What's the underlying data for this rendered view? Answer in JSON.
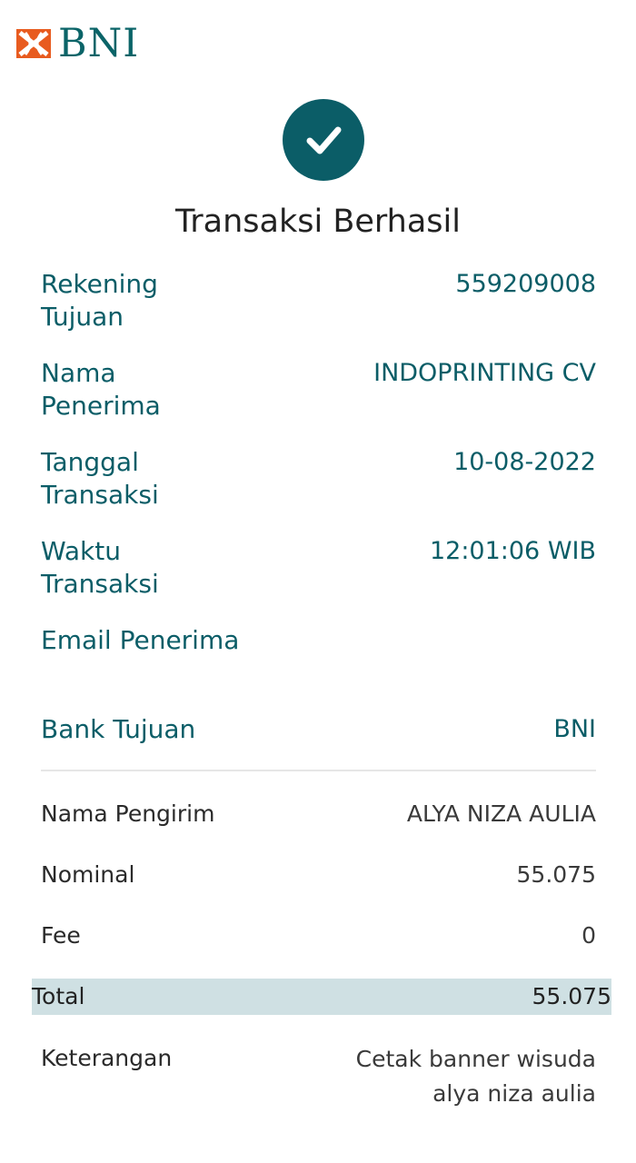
{
  "brand": {
    "name": "BNI",
    "colors": {
      "teal": "#0b5d67",
      "orange": "#e85b1f",
      "highlight": "#cfe0e3"
    }
  },
  "status": {
    "icon": "check-icon",
    "title": "Transaksi Berhasil"
  },
  "recipient": [
    {
      "label": "Rekening Tujuan",
      "value": "559209008"
    },
    {
      "label": "Nama Penerima",
      "value": "INDOPRINTING CV"
    },
    {
      "label": "Tanggal Transaksi",
      "value": "10-08-2022"
    },
    {
      "label": "Waktu Transaksi",
      "value": "12:01:06 WIB"
    },
    {
      "label": "Email Penerima",
      "value": ""
    },
    {
      "label": "Bank Tujuan",
      "value": "BNI"
    }
  ],
  "details": {
    "sender": {
      "label": "Nama Pengirim",
      "value": "ALYA NIZA AULIA"
    },
    "nominal": {
      "label": "Nominal",
      "value": "55.075"
    },
    "fee": {
      "label": "Fee",
      "value": "0"
    },
    "total": {
      "label": "Total",
      "value": "55.075"
    },
    "note": {
      "label": "Keterangan",
      "line1": "Cetak banner wisuda",
      "line2": "alya niza aulia"
    }
  }
}
